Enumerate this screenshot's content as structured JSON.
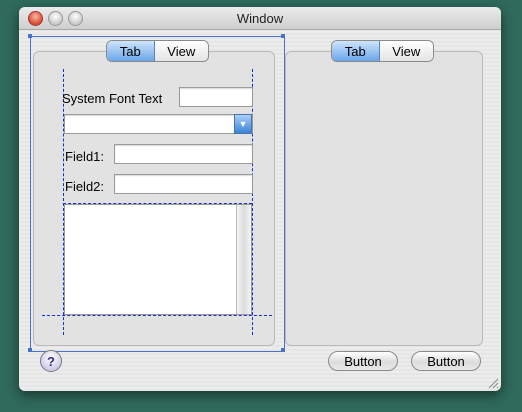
{
  "window": {
    "title": "Window"
  },
  "left_tab": {
    "tab1": "Tab",
    "tab2": "View"
  },
  "right_tab": {
    "tab1": "Tab",
    "tab2": "View"
  },
  "form": {
    "system_font_label": "System Font Text",
    "system_font_value": "",
    "combo_value": "",
    "field1_label": "Field1:",
    "field1_value": "",
    "field2_label": "Field2:",
    "field2_value": ""
  },
  "footer": {
    "help": "?",
    "button1": "Button",
    "button2": "Button"
  },
  "icons": {
    "close": "close-icon",
    "minimize": "minimize-icon",
    "zoom": "zoom-icon",
    "combo_arrow": "chevron-down-icon",
    "help": "help-icon",
    "resize": "resize-grip-icon"
  }
}
